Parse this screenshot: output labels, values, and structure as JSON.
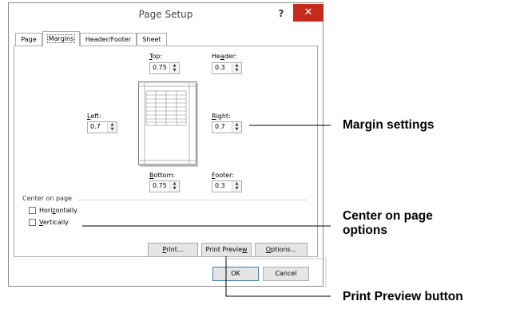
{
  "dialog": {
    "title": "Page Setup",
    "help_label": "?",
    "close_label": "✕",
    "tabs": [
      {
        "label": "Page"
      },
      {
        "label": "Margins"
      },
      {
        "label": "Header/Footer"
      },
      {
        "label": "Sheet"
      }
    ],
    "fields": {
      "top": {
        "pre": "",
        "key": "T",
        "post": "op:",
        "value": "0.75"
      },
      "header": {
        "pre": "He",
        "key": "a",
        "post": "der:",
        "value": "0.3"
      },
      "left": {
        "pre": "",
        "key": "L",
        "post": "eft:",
        "value": "0.7"
      },
      "right": {
        "pre": "",
        "key": "R",
        "post": "ight:",
        "value": "0.7"
      },
      "bottom": {
        "pre": "",
        "key": "B",
        "post": "ottom:",
        "value": "0.75"
      },
      "footer": {
        "pre": "",
        "key": "F",
        "post": "ooter:",
        "value": "0.3"
      }
    },
    "center_on_page": {
      "label": "Center on page",
      "horizontally": {
        "pre": "Hori",
        "key": "z",
        "post": "ontally",
        "checked": false
      },
      "vertically": {
        "pre": "",
        "key": "V",
        "post": "ertically",
        "checked": false
      }
    },
    "buttons": {
      "print": {
        "pre": "",
        "key": "P",
        "post": "rint..."
      },
      "print_preview": {
        "pre": "Print Previe",
        "key": "w",
        "post": ""
      },
      "options": {
        "pre": "",
        "key": "O",
        "post": "ptions..."
      },
      "ok": "OK",
      "cancel": "Cancel"
    }
  },
  "callouts": {
    "margin_settings": "Margin settings",
    "center_line1": "Center on page",
    "center_line2": "options",
    "print_preview_button": "Print Preview button"
  },
  "colors": {
    "close_button": "#c42b1c",
    "default_button_border": "#3c7fb1"
  }
}
